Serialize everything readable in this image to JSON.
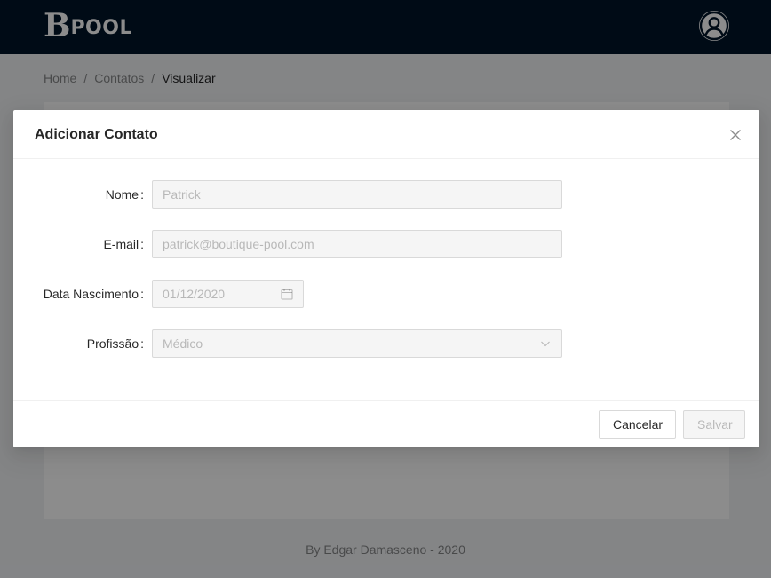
{
  "header": {
    "logo_letter": "B",
    "logo_text": "POOL",
    "background_color": "#001529",
    "avatar_icon": "user-circle-icon"
  },
  "breadcrumb": {
    "items": [
      "Home",
      "Contatos",
      "Visualizar"
    ],
    "separator": "/"
  },
  "footer": {
    "text": "By Edgar Damasceno - 2020"
  },
  "modal": {
    "title": "Adicionar Contato",
    "close_icon": "close-icon",
    "fields": {
      "nome": {
        "label": "Nome",
        "value": "Patrick",
        "disabled": true
      },
      "email": {
        "label": "E-mail",
        "value": "patrick@boutique-pool.com",
        "disabled": true
      },
      "data_nascimento": {
        "label": "Data Nascimento",
        "value": "01/12/2020",
        "icon": "calendar-icon",
        "disabled": true
      },
      "profissao": {
        "label": "Profissão",
        "value": "Médico",
        "icon": "chevron-down-icon",
        "disabled": true
      }
    },
    "colon": ":",
    "buttons": {
      "cancel_label": "Cancelar",
      "save_label": "Salvar",
      "save_disabled": true
    }
  }
}
